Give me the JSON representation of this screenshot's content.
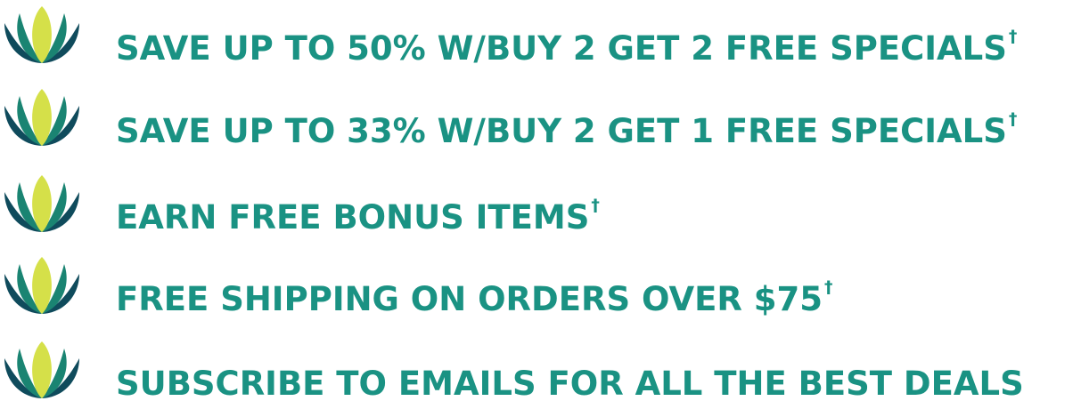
{
  "colors": {
    "text": "#1a9283",
    "petal_center": "#d5e049",
    "petal_middle": "#1a8472",
    "petal_outer": "#0f4b5c"
  },
  "icon": "lotus-icon",
  "benefits": [
    {
      "text": "SAVE UP TO 50% W/BUY 2 GET 2 FREE SPECIALS",
      "mark": "†"
    },
    {
      "text": "SAVE UP TO 33% W/BUY 2 GET 1 FREE SPECIALS",
      "mark": "†"
    },
    {
      "text": "EARN FREE BONUS ITEMS",
      "mark": "†"
    },
    {
      "text": "FREE SHIPPING ON ORDERS OVER $75",
      "mark": "†"
    },
    {
      "text": "SUBSCRIBE TO EMAILS FOR ALL THE BEST DEALS",
      "mark": ""
    }
  ]
}
